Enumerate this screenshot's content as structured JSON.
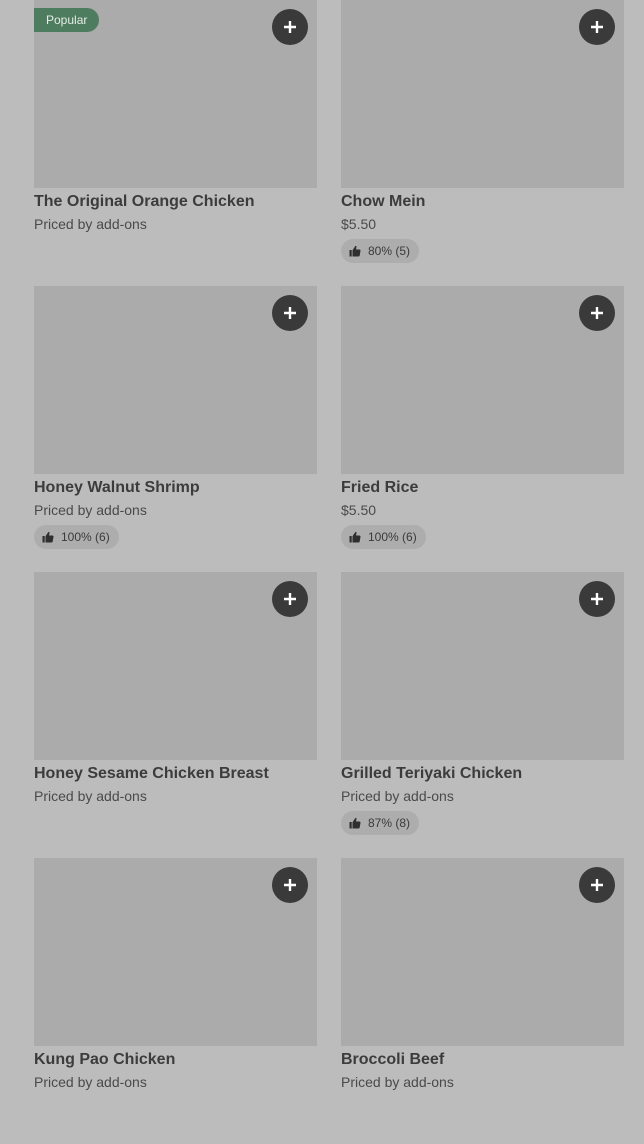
{
  "colors": {
    "page_background": "#bcbcbc",
    "image_placeholder": "#ababab",
    "add_button": "#3a3a3a",
    "popular_badge": "#4d7d5e",
    "rating_pill": "#adadad"
  },
  "icons": {
    "add": "plus-icon",
    "rating": "thumbs-up-icon"
  },
  "menu": {
    "items": [
      {
        "name": "The Original Orange Chicken",
        "price": "Priced by add-ons",
        "badge": "Popular",
        "rating": null
      },
      {
        "name": "Chow Mein",
        "price": "$5.50",
        "badge": null,
        "rating": "80% (5)"
      },
      {
        "name": "Honey Walnut Shrimp",
        "price": "Priced by add-ons",
        "badge": null,
        "rating": "100% (6)"
      },
      {
        "name": "Fried Rice",
        "price": "$5.50",
        "badge": null,
        "rating": "100% (6)"
      },
      {
        "name": "Honey Sesame Chicken Breast",
        "price": "Priced by add-ons",
        "badge": null,
        "rating": null
      },
      {
        "name": "Grilled Teriyaki Chicken",
        "price": "Priced by add-ons",
        "badge": null,
        "rating": "87% (8)"
      },
      {
        "name": "Kung Pao Chicken",
        "price": "Priced by add-ons",
        "badge": null,
        "rating": null
      },
      {
        "name": "Broccoli Beef",
        "price": "Priced by add-ons",
        "badge": null,
        "rating": null
      }
    ]
  }
}
